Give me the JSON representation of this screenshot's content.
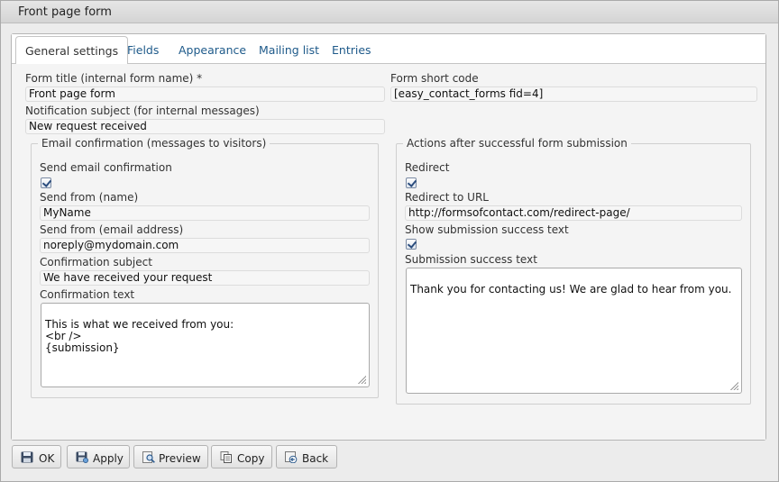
{
  "window": {
    "title": "Front page form"
  },
  "tabs": [
    {
      "label": "General settings",
      "active": true
    },
    {
      "label": "Fields"
    },
    {
      "label": "Appearance"
    },
    {
      "label": "Mailing list"
    },
    {
      "label": "Entries"
    }
  ],
  "form": {
    "title_label": "Form title (internal form name) *",
    "title_value": "Front page form",
    "shortcode_label": "Form short code",
    "shortcode_value": "[easy_contact_forms fid=4]",
    "subject_label": "Notification subject (for internal messages)",
    "subject_value": "New request received"
  },
  "email_confirmation": {
    "legend": "Email confirmation (messages to visitors)",
    "send_label": "Send email confirmation",
    "send_checked": true,
    "from_name_label": "Send from (name)",
    "from_name_value": "MyName",
    "from_email_label": "Send from (email address)",
    "from_email_value": "noreply@mydomain.com",
    "conf_subject_label": "Confirmation subject",
    "conf_subject_value": "We have received your request",
    "conf_text_label": "Confirmation text",
    "conf_text_value": "This is what we received from you:\n<br />\n{submission}"
  },
  "actions": {
    "legend": "Actions after successful form submission",
    "redirect_label": "Redirect",
    "redirect_checked": true,
    "redirect_url_label": "Redirect to URL",
    "redirect_url_value": "http://formsofcontact.com/redirect-page/",
    "show_success_label": "Show submission success text",
    "show_success_checked": true,
    "success_text_label": "Submission success text",
    "success_text_value": "Thank you for contacting us! We are glad to hear from you."
  },
  "buttons": {
    "ok": "OK",
    "apply": "Apply",
    "preview": "Preview",
    "copy": "Copy",
    "back": "Back"
  }
}
